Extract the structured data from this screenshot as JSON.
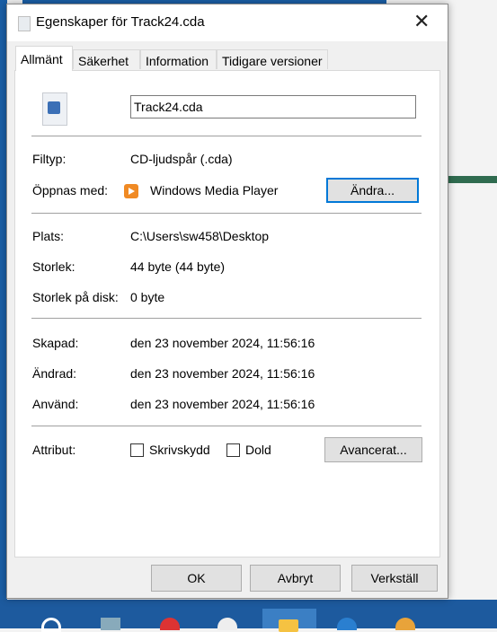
{
  "window": {
    "title": "Egenskaper för Track24.cda",
    "close_icon": "close-icon"
  },
  "tabs": [
    {
      "label": "Allmänt",
      "active": true
    },
    {
      "label": "Säkerhet"
    },
    {
      "label": "Information"
    },
    {
      "label": "Tidigare versioner"
    }
  ],
  "general": {
    "file_name": "Track24.cda",
    "file_type_label": "Filtyp:",
    "file_type": "CD-ljudspår (.cda)",
    "opens_with_label": "Öppnas med:",
    "opens_with": "Windows Media Player",
    "change_button": "Ändra...",
    "location_label": "Plats:",
    "location": "C:\\Users\\sw458\\Desktop",
    "size_label": "Storlek:",
    "size": "44 byte (44 byte)",
    "size_on_disk_label": "Storlek på disk:",
    "size_on_disk": "0 byte",
    "created_label": "Skapad:",
    "created": "den 23 november 2024, 11:56:16",
    "modified_label": "Ändrad:",
    "modified": "den 23 november 2024, 11:56:16",
    "accessed_label": "Använd:",
    "accessed": "den 23 november 2024, 11:56:16",
    "attributes_label": "Attribut:",
    "readonly_label": "Skrivskydd",
    "readonly_checked": false,
    "hidden_label": "Dold",
    "hidden_checked": false,
    "advanced_button": "Avancerat..."
  },
  "footer": {
    "ok": "OK",
    "cancel": "Avbryt",
    "apply": "Verkställ"
  }
}
